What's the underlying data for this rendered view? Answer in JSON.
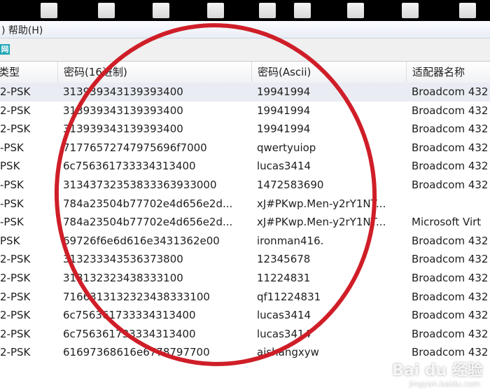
{
  "menu": {
    "help_label": ") 帮助(H)"
  },
  "toolbar": {
    "icon_glyph": "网"
  },
  "columns": [
    {
      "label": "类型"
    },
    {
      "label": "密码(16进制)"
    },
    {
      "label": "密码(Ascii)"
    },
    {
      "label": "适配器名称"
    }
  ],
  "rows": [
    {
      "type": "2-PSK",
      "hex": "313939343139393400",
      "ascii": "19941994",
      "adapter": "Broadcom 432"
    },
    {
      "type": "2-PSK",
      "hex": "313939343139393400",
      "ascii": "19941994",
      "adapter": "Broadcom 432"
    },
    {
      "type": "2-PSK",
      "hex": "313939343139393400",
      "ascii": "19941994",
      "adapter": "Broadcom 432"
    },
    {
      "type": "-PSK",
      "hex": "71776572747975696f7000",
      "ascii": "qwertyuiop",
      "adapter": "Broadcom 432"
    },
    {
      "type": "PSK",
      "hex": "6c756361733334313400",
      "ascii": "lucas3414",
      "adapter": "Broadcom 432"
    },
    {
      "type": "-PSK",
      "hex": "31343732353833363933000",
      "ascii": "1472583690",
      "adapter": "Broadcom 432"
    },
    {
      "type": "-PSK",
      "hex": "784a23504b77702e4d656e2d...",
      "ascii": "xJ#PKwp.Men-y2rY1NT...",
      "adapter": ""
    },
    {
      "type": "-PSK",
      "hex": "784a23504b77702e4d656e2d...",
      "ascii": "xJ#PKwp.Men-y2rY1NT...",
      "adapter": "Microsoft Virt"
    },
    {
      "type": "PSK",
      "hex": "69726f6e6d616e3431362e00",
      "ascii": "ironman416.",
      "adapter": "Broadcom 432"
    },
    {
      "type": "2-PSK",
      "hex": "313233343536373800",
      "ascii": "12345678",
      "adapter": "Broadcom 432"
    },
    {
      "type": "2-PSK",
      "hex": "313132323438333100",
      "ascii": "11224831",
      "adapter": "Broadcom 432"
    },
    {
      "type": "2-PSK",
      "hex": "7166313132323438333100",
      "ascii": "qf11224831",
      "adapter": "Broadcom 432"
    },
    {
      "type": "2-PSK",
      "hex": "6c756361733334313400",
      "ascii": "lucas3414",
      "adapter": "Broadcom 432"
    },
    {
      "type": "2-PSK",
      "hex": "6c756361733334313400",
      "ascii": "lucas3414",
      "adapter": "Broadcom 432"
    },
    {
      "type": "2-PSK",
      "hex": "61697368616e6778797700",
      "ascii": "aishangxyw",
      "adapter": "Broadcom 432"
    }
  ],
  "watermark": {
    "main": "Bai du 经验",
    "sub": "jingyan.baidu.com"
  },
  "colors": {
    "annotation_circle": "#cf1e28",
    "selection": "#e9edf3"
  }
}
